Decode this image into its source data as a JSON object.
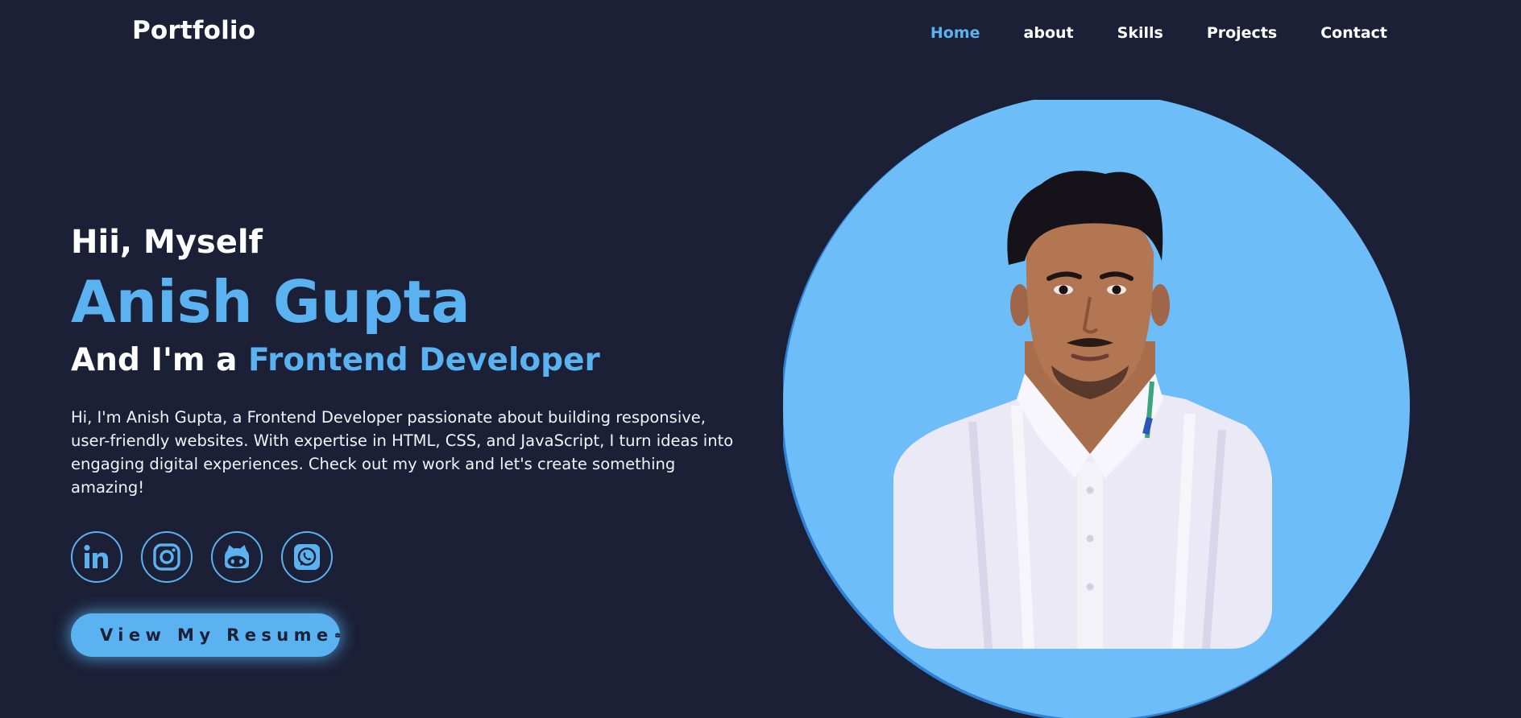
{
  "header": {
    "logo": "Portfolio",
    "nav": [
      {
        "label": "Home",
        "active": true
      },
      {
        "label": "about",
        "active": false
      },
      {
        "label": "Skills",
        "active": false
      },
      {
        "label": "Projects",
        "active": false
      },
      {
        "label": "Contact",
        "active": false
      }
    ]
  },
  "hero": {
    "greeting": "Hii, Myself",
    "name": "Anish Gupta",
    "role_prefix": "And I'm a ",
    "role_highlight": "Frontend Developer",
    "bio": "Hi, I'm Anish Gupta, a Frontend Developer passionate about building responsive, user-friendly websites. With expertise in HTML, CSS, and JavaScript, I turn ideas into engaging digital experiences. Check out my work and let's create something amazing!",
    "socials": [
      {
        "icon": "linkedin-icon"
      },
      {
        "icon": "instagram-icon"
      },
      {
        "icon": "github-icon"
      },
      {
        "icon": "whatsapp-icon"
      }
    ],
    "resume_label": "View My Resume",
    "resume_icon": "briefcase-icon"
  },
  "photo": {
    "icon": "profile-photo"
  },
  "colors": {
    "background": "#1b2037",
    "accent": "#5bb2f0",
    "text": "#ffffff",
    "photo_circle": "#6cbdf8"
  }
}
